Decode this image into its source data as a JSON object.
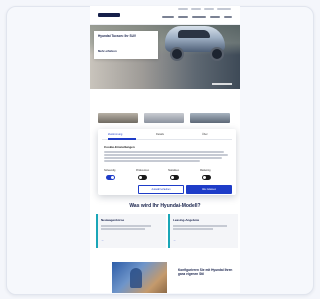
{
  "site": {
    "brand": "HYUNDAI"
  },
  "hero": {
    "title": "Hyundai Tucson: Ihr SUV",
    "cta": "Mehr erfahren"
  },
  "cookie_banner": {
    "tabs": [
      "Zustimmung",
      "Details",
      "Über"
    ],
    "active_tab": 0,
    "heading": "Cookie-Einstellungen",
    "categories": [
      {
        "label": "Notwendig",
        "on": true
      },
      {
        "label": "Präferenzen",
        "on": false
      },
      {
        "label": "Statistiken",
        "on": false
      },
      {
        "label": "Marketing",
        "on": false
      }
    ],
    "button_secondary": "Auswahl erlauben",
    "button_primary": "Alle zulassen"
  },
  "section": {
    "title": "Was wird Ihr Hyundai-Modell?"
  },
  "offers": [
    {
      "title": "Neuwagenbörse",
      "arrow": "→"
    },
    {
      "title": "Leasing-Angebote",
      "arrow": "→"
    }
  ],
  "promo": {
    "title": "Konfigurieren Sie mit Hyundai Ihren ganz eigenen Stil"
  },
  "colors": {
    "brand_navy": "#16204a",
    "accent_blue": "#1e3cc8",
    "teal": "#1aa6b7"
  }
}
